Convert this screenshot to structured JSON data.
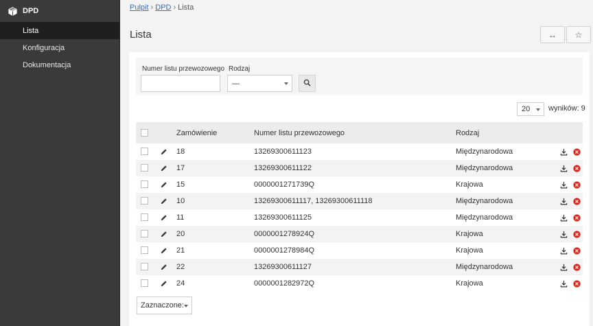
{
  "sidebar": {
    "brand": "DPD",
    "items": [
      {
        "label": "Lista",
        "active": true
      },
      {
        "label": "Konfiguracja",
        "active": false
      },
      {
        "label": "Dokumentacja",
        "active": false
      }
    ]
  },
  "breadcrumb": {
    "items": [
      "Pulpit",
      "DPD",
      "Lista"
    ],
    "separator": "›"
  },
  "header": {
    "title": "Lista",
    "expand_icon": "↔",
    "star_icon": "☆"
  },
  "filters": {
    "number_label": "Numer listu przewozowego",
    "number_value": "",
    "type_label": "Rodzaj",
    "type_value": "—"
  },
  "pagination": {
    "per_page": "20",
    "results": "wyników: 9"
  },
  "table": {
    "columns": {
      "order": "Zamówienie",
      "number": "Numer listu przewozowego",
      "type": "Rodzaj"
    },
    "rows": [
      {
        "order": "18",
        "number": "13269300611123",
        "type": "Międzynarodowa"
      },
      {
        "order": "17",
        "number": "13269300611122",
        "type": "Międzynarodowa"
      },
      {
        "order": "15",
        "number": "0000001271739Q",
        "type": "Krajowa"
      },
      {
        "order": "10",
        "number": "13269300611117, 13269300611118",
        "type": "Międzynarodowa"
      },
      {
        "order": "11",
        "number": "13269300611125",
        "type": "Międzynarodowa"
      },
      {
        "order": "20",
        "number": "0000001278924Q",
        "type": "Krajowa"
      },
      {
        "order": "21",
        "number": "0000001278984Q",
        "type": "Krajowa"
      },
      {
        "order": "22",
        "number": "13269300611127",
        "type": "Międzynarodowa"
      },
      {
        "order": "24",
        "number": "0000001282972Q",
        "type": "Krajowa"
      }
    ]
  },
  "bulk": {
    "label": "Zaznaczone:"
  },
  "colors": {
    "sidebar_bg": "#3a3a3a",
    "sidebar_active": "#1f1f1f",
    "link": "#3a6fb0",
    "delete_red": "#d9261c"
  }
}
